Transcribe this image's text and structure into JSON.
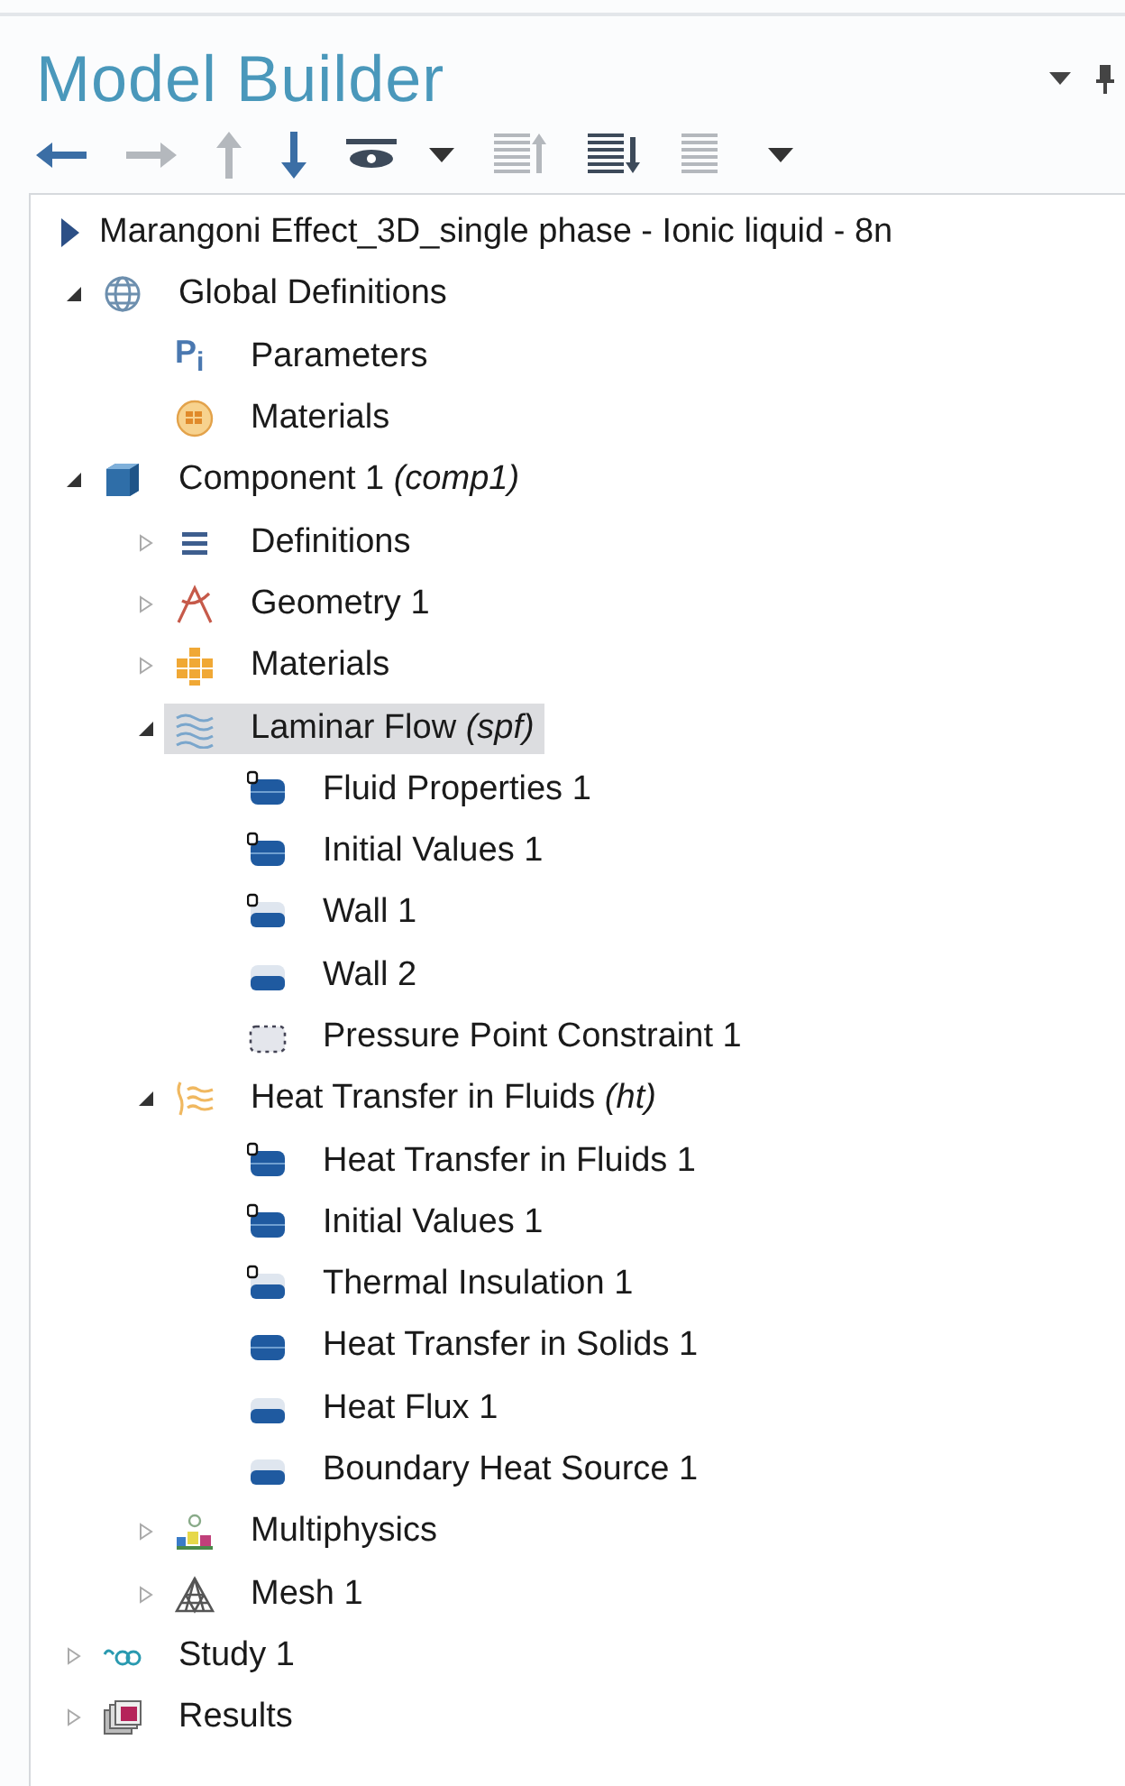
{
  "panel": {
    "title": "Model Builder",
    "header_tools": [
      {
        "kind": "dropdown"
      },
      {
        "kind": "pin"
      }
    ],
    "toolbar": [
      {
        "kind": "back",
        "disabled": false
      },
      {
        "kind": "forward",
        "disabled": true
      },
      {
        "kind": "up",
        "disabled": true
      },
      {
        "kind": "down",
        "disabled": false
      },
      {
        "kind": "show",
        "disabled": false
      },
      {
        "kind": "dropdown",
        "disabled": false
      },
      {
        "kind": "collapse-all",
        "disabled": true
      },
      {
        "kind": "expand-all",
        "disabled": false
      },
      {
        "kind": "list",
        "disabled": true
      },
      {
        "kind": "dropdown",
        "disabled": false
      }
    ]
  },
  "tree": [
    {
      "label": "Marangoni Effect_3D_single phase - Ionic liquid - 8n",
      "kind": "model",
      "selected": false,
      "children": [
        {
          "label": "Global Definitions",
          "kind": "globe",
          "expanded": true,
          "selected": false,
          "children": [
            {
              "label": "Parameters",
              "glyph": "P$_{i}$",
              "selected": false
            },
            {
              "label": "Materials",
              "kind": "material-ball",
              "selected": false
            }
          ]
        },
        {
          "label": "Component 1 *(comp1)*",
          "kind": "cube",
          "expanded": true,
          "selected": false,
          "children": [
            {
              "label": "Definitions",
              "kind": "definitions",
              "expanded": false,
              "selected": false
            },
            {
              "label": "Geometry 1",
              "kind": "geometry",
              "expanded": false,
              "selected": false
            },
            {
              "label": "Materials",
              "kind": "materials",
              "expanded": false,
              "selected": false
            },
            {
              "label": "Laminar Flow *(spf)*",
              "kind": "laminar",
              "expanded": true,
              "selected": true,
              "children": [
                {
                  "label": "Fluid Properties 1",
                  "kind": "domain",
                  "default": true,
                  "selected": false
                },
                {
                  "label": "Initial Values 1",
                  "kind": "domain",
                  "default": true,
                  "selected": false
                },
                {
                  "label": "Wall 1",
                  "kind": "boundary",
                  "default": true,
                  "selected": false
                },
                {
                  "label": "Wall 2",
                  "kind": "boundary",
                  "default": false,
                  "selected": false
                },
                {
                  "label": "Pressure Point Constraint 1",
                  "kind": "point",
                  "default": false,
                  "selected": false
                }
              ]
            },
            {
              "label": "Heat Transfer in Fluids *(ht)*",
              "kind": "heat",
              "expanded": true,
              "selected": false,
              "children": [
                {
                  "label": "Heat Transfer in Fluids 1",
                  "kind": "domain",
                  "default": true,
                  "selected": false
                },
                {
                  "label": "Initial Values 1",
                  "kind": "domain",
                  "default": true,
                  "selected": false
                },
                {
                  "label": "Thermal Insulation 1",
                  "kind": "boundary",
                  "default": true,
                  "selected": false
                },
                {
                  "label": "Heat Transfer in Solids 1",
                  "kind": "domain",
                  "default": false,
                  "selected": false
                },
                {
                  "label": "Heat Flux 1",
                  "kind": "boundary",
                  "default": false,
                  "selected": false
                },
                {
                  "label": "Boundary Heat Source 1",
                  "kind": "boundary",
                  "default": false,
                  "selected": false
                }
              ]
            },
            {
              "label": "Multiphysics",
              "kind": "multiphysics",
              "expanded": false,
              "selected": false
            },
            {
              "label": "Mesh 1",
              "kind": "mesh",
              "expanded": false,
              "selected": false
            }
          ]
        },
        {
          "label": "Study 1",
          "kind": "study",
          "expanded": false,
          "selected": false
        },
        {
          "label": "Results",
          "kind": "results",
          "expanded": false,
          "selected": false
        }
      ]
    }
  ]
}
